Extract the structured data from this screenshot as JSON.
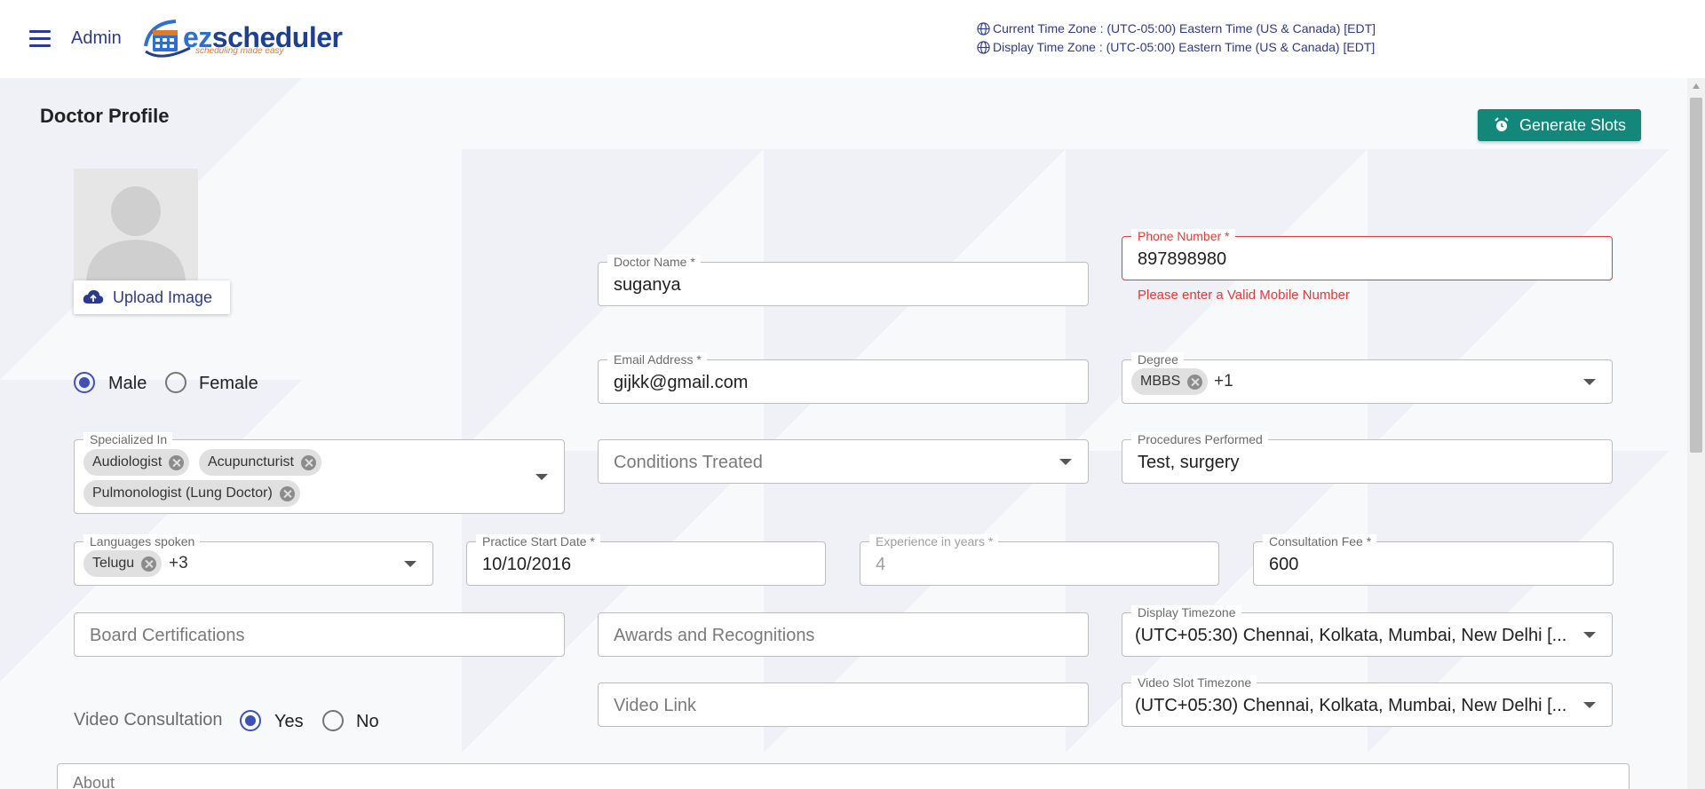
{
  "header": {
    "admin_label": "Admin",
    "logo_ez": "ez",
    "logo_scheduler": "scheduler",
    "logo_tagline": "scheduling made easy",
    "current_tz": "Current Time Zone : (UTC-05:00) Eastern Time (US & Canada) [EDT]",
    "display_tz": "Display Time Zone : (UTC-05:00) Eastern Time (US & Canada) [EDT]"
  },
  "page": {
    "title": "Doctor Profile",
    "generate_slots": "Generate Slots",
    "upload_image": "Upload Image"
  },
  "form": {
    "doctor_name": {
      "label": "Doctor Name *",
      "value": "suganya"
    },
    "phone": {
      "label": "Phone Number *",
      "value": "897898980",
      "error": "Please enter a Valid Mobile Number"
    },
    "gender": {
      "options": [
        "Male",
        "Female"
      ],
      "selected": "Male"
    },
    "email": {
      "label": "Email Address *",
      "value": "gijkk@gmail.com"
    },
    "degree": {
      "label": "Degree",
      "chips": [
        "MBBS"
      ],
      "more": "+1"
    },
    "specialized": {
      "label": "Specialized In",
      "chips": [
        "Audiologist",
        "Acupuncturist",
        "Pulmonologist (Lung Doctor)"
      ]
    },
    "conditions": {
      "placeholder": "Conditions Treated"
    },
    "procedures": {
      "label": "Procedures Performed",
      "value": "Test, surgery"
    },
    "languages": {
      "label": "Languages spoken",
      "chips": [
        "Telugu"
      ],
      "more": "+3"
    },
    "practice_start": {
      "label": "Practice Start Date *",
      "value": "10/10/2016"
    },
    "experience": {
      "label": "Experience in years *",
      "value": "4"
    },
    "fee": {
      "label": "Consultation Fee  *",
      "value": "600"
    },
    "board": {
      "placeholder": "Board Certifications"
    },
    "awards": {
      "placeholder": "Awards and Recognitions"
    },
    "display_timezone": {
      "label": "Display Timezone",
      "value": "(UTC+05:30) Chennai, Kolkata, Mumbai, New Delhi [..."
    },
    "video_link": {
      "placeholder": "Video Link"
    },
    "video_timezone": {
      "label": "Video Slot Timezone",
      "value": "(UTC+05:30) Chennai, Kolkata, Mumbai, New Delhi [..."
    },
    "video_consultation": {
      "label": "Video Consultation",
      "options": [
        "Yes",
        "No"
      ],
      "selected": "Yes"
    },
    "about": {
      "placeholder": "About"
    }
  },
  "colors": {
    "primary": "#3f51b5",
    "header_text": "#2d3a8c",
    "button": "#12877a",
    "error": "#e53935"
  },
  "icons": [
    "menu-icon",
    "globe-icon",
    "alarm-icon",
    "cloud-upload-icon",
    "cancel-chip-icon",
    "dropdown-arrow-icon"
  ]
}
